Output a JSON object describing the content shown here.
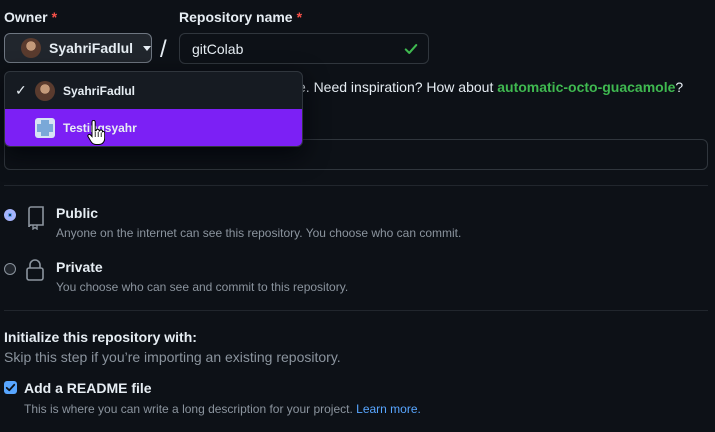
{
  "owner": {
    "label": "Owner",
    "required_mark": "*",
    "selected": "SyahriFadlul"
  },
  "repo": {
    "label": "Repository name",
    "required_mark": "*",
    "value": "gitColab",
    "separator": "/"
  },
  "inspiration": {
    "prefix": "e. Need inspiration? How about ",
    "suggestion": "automatic-octo-guacamole",
    "suffix": "?"
  },
  "dropdown": {
    "items": [
      {
        "label": "SyahriFadlul",
        "selected": true,
        "icon": "user-avatar"
      },
      {
        "label": "Testingsyahr",
        "hovered": true,
        "icon": "org-avatar"
      }
    ]
  },
  "visibility": {
    "public": {
      "title": "Public",
      "desc": "Anyone on the internet can see this repository. You choose who can commit.",
      "icon": "repo-icon",
      "checked": true
    },
    "private": {
      "title": "Private",
      "desc": "You choose who can see and commit to this repository.",
      "icon": "lock-icon",
      "checked": false
    }
  },
  "init": {
    "title": "Initialize this repository with:",
    "subtitle": "Skip this step if you’re importing an existing repository.",
    "readme": {
      "label": "Add a README file",
      "desc": "This is where you can write a long description for your project. ",
      "link": "Learn more.",
      "checked": true
    }
  },
  "colors": {
    "background": "#0d1117",
    "accent_link": "#58a6ff",
    "success": "#3fb950",
    "hover_purple": "#7c20f5",
    "required": "#f85149"
  }
}
